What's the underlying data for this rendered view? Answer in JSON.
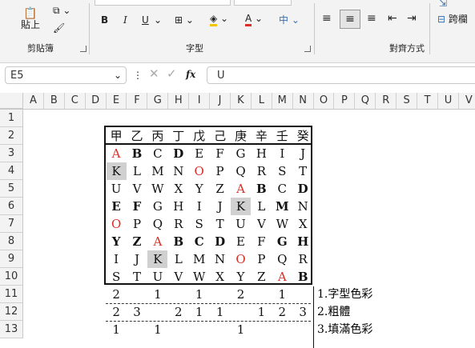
{
  "ribbon": {
    "paste": "貼上",
    "clipboard": "剪貼簿",
    "font": "字型",
    "align": "對齊方式",
    "bold": "B",
    "italic": "I",
    "underline": "U",
    "wrap": "跨欄"
  },
  "formula_bar": {
    "name_box": "E5",
    "fx": "fx",
    "content": "U"
  },
  "columns": [
    "A",
    "B",
    "C",
    "D",
    "E",
    "F",
    "G",
    "H",
    "I",
    "J",
    "K",
    "L",
    "M",
    "N",
    "O",
    "P",
    "Q",
    "R",
    "S",
    "T",
    "U",
    "V"
  ],
  "rows": [
    "1",
    "2",
    "3",
    "4",
    "5",
    "6",
    "7",
    "8",
    "9",
    "10",
    "11",
    "12",
    "13"
  ],
  "header": [
    "甲",
    "乙",
    "丙",
    "丁",
    "戊",
    "己",
    "庚",
    "辛",
    "壬",
    "癸"
  ],
  "grid": [
    [
      "A",
      "B",
      "C",
      "D",
      "E",
      "F",
      "G",
      "H",
      "I",
      "J"
    ],
    [
      "K",
      "L",
      "M",
      "N",
      "O",
      "P",
      "Q",
      "R",
      "S",
      "T"
    ],
    [
      "U",
      "V",
      "W",
      "X",
      "Y",
      "Z",
      "A",
      "B",
      "C",
      "D"
    ],
    [
      "E",
      "F",
      "G",
      "H",
      "I",
      "J",
      "K",
      "L",
      "M",
      "N"
    ],
    [
      "O",
      "P",
      "Q",
      "R",
      "S",
      "T",
      "U",
      "V",
      "W",
      "X"
    ],
    [
      "Y",
      "Z",
      "A",
      "B",
      "C",
      "D",
      "E",
      "F",
      "G",
      "H"
    ],
    [
      "I",
      "J",
      "K",
      "L",
      "M",
      "N",
      "O",
      "P",
      "Q",
      "R"
    ],
    [
      "S",
      "T",
      "U",
      "V",
      "W",
      "X",
      "Y",
      "Z",
      "A",
      "B"
    ]
  ],
  "styles": {
    "red": [
      "0,0",
      "1,4",
      "2,6",
      "4,0",
      "5,2",
      "6,6",
      "7,8"
    ],
    "bold": [
      "0,1",
      "0,3",
      "2,7",
      "2,9",
      "3,0",
      "3,1",
      "3,8",
      "5,0",
      "5,1",
      "5,3",
      "5,4",
      "5,5",
      "5,8",
      "5,9",
      "7,9"
    ],
    "fill": [
      "1,0",
      "3,6",
      "6,2"
    ]
  },
  "summary": {
    "row11": [
      "2",
      "",
      "1",
      "",
      "1",
      "",
      "2",
      "",
      "1",
      ""
    ],
    "row12": [
      "2",
      "3",
      "",
      "2",
      "1",
      "1",
      "",
      "1",
      "2",
      "3"
    ],
    "row13": [
      "1",
      "",
      "1",
      "",
      "",
      "",
      "1",
      "",
      "",
      ""
    ],
    "labels": [
      "1.字型色彩",
      "2.粗體",
      "3.填滿色彩"
    ]
  }
}
